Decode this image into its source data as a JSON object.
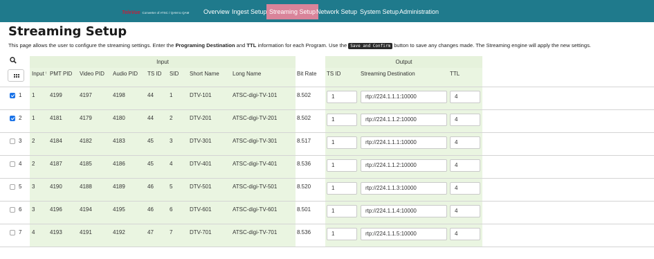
{
  "nav": {
    "brand_name": "TeleVue",
    "brand_tagline": "Converter of ATSC / QAM to QAM",
    "items": [
      "Overview",
      "Ingest Setup",
      "Streaming Setup",
      "Network Setup",
      "System Setup",
      "Administration"
    ],
    "active": "Streaming Setup"
  },
  "header": {
    "title": "Streaming Setup",
    "desc_1": "This page allows the user to configure the streaming settings. Enter the ",
    "desc_b1": "Programing Destination",
    "desc_2": " and ",
    "desc_b2": "TTL",
    "desc_3": " information for each Program. Use the ",
    "desc_kbd": "Save and Confirm",
    "desc_4": " button to save any changes made. The Streaming engine will apply the new settings."
  },
  "table": {
    "group_input": "Input",
    "group_output": "Output",
    "columns": {
      "input": "Input",
      "sort_mark": "↑",
      "pmt_pid": "PMT PID",
      "video_pid": "Video PID",
      "audio_pid": "Audio PID",
      "ts_id": "TS ID",
      "sid": "SID",
      "short_name": "Short Name",
      "long_name": "Long Name",
      "bit_rate": "Bit Rate",
      "out_ts_id": "TS ID",
      "dest": "Streaming Destination",
      "ttl": "TTL"
    },
    "rows": [
      {
        "n": "1",
        "checked": true,
        "input": "1",
        "pmt": "4199",
        "video": "4197",
        "audio": "4198",
        "ts": "44",
        "sid": "1",
        "short": "DTV-101",
        "long": "ATSC-digi-TV-101",
        "rate": "8.502",
        "out_ts": "1",
        "dest": "rtp://224.1.1.1:10000",
        "ttl": "4"
      },
      {
        "n": "2",
        "checked": true,
        "input": "1",
        "pmt": "4181",
        "video": "4179",
        "audio": "4180",
        "ts": "44",
        "sid": "2",
        "short": "DTV-201",
        "long": "ATSC-digi-TV-201",
        "rate": "8.502",
        "out_ts": "1",
        "dest": "rtp://224.1.1.2:10000",
        "ttl": "4"
      },
      {
        "n": "3",
        "checked": false,
        "input": "2",
        "pmt": "4184",
        "video": "4182",
        "audio": "4183",
        "ts": "45",
        "sid": "3",
        "short": "DTV-301",
        "long": "ATSC-digi-TV-301",
        "rate": "8.517",
        "out_ts": "1",
        "dest": "rtp://224.1.1.1:10000",
        "ttl": "4"
      },
      {
        "n": "4",
        "checked": false,
        "input": "2",
        "pmt": "4187",
        "video": "4185",
        "audio": "4186",
        "ts": "45",
        "sid": "4",
        "short": "DTV-401",
        "long": "ATSC-digi-TV-401",
        "rate": "8.536",
        "out_ts": "1",
        "dest": "rtp://224.1.1.2:10000",
        "ttl": "4"
      },
      {
        "n": "5",
        "checked": false,
        "input": "3",
        "pmt": "4190",
        "video": "4188",
        "audio": "4189",
        "ts": "46",
        "sid": "5",
        "short": "DTV-501",
        "long": "ATSC-digi-TV-501",
        "rate": "8.520",
        "out_ts": "1",
        "dest": "rtp://224.1.1.3:10000",
        "ttl": "4"
      },
      {
        "n": "6",
        "checked": false,
        "input": "3",
        "pmt": "4196",
        "video": "4194",
        "audio": "4195",
        "ts": "46",
        "sid": "6",
        "short": "DTV-601",
        "long": "ATSC-digi-TV-601",
        "rate": "8.501",
        "out_ts": "1",
        "dest": "rtp://224.1.1.4:10000",
        "ttl": "4"
      },
      {
        "n": "7",
        "checked": false,
        "input": "4",
        "pmt": "4193",
        "video": "4191",
        "audio": "4192",
        "ts": "47",
        "sid": "7",
        "short": "DTV-701",
        "long": "ATSC-digi-TV-701",
        "rate": "8.536",
        "out_ts": "1",
        "dest": "rtp://224.1.1.5:10000",
        "ttl": "4"
      }
    ]
  },
  "colors": {
    "navbar": "#1f7a8c",
    "active_tab": "#d9849a",
    "input_group_bg": "#eaf5e1",
    "checkbox_on": "#1a73e8"
  },
  "icons": [
    "search-icon",
    "column-grid-icon"
  ]
}
